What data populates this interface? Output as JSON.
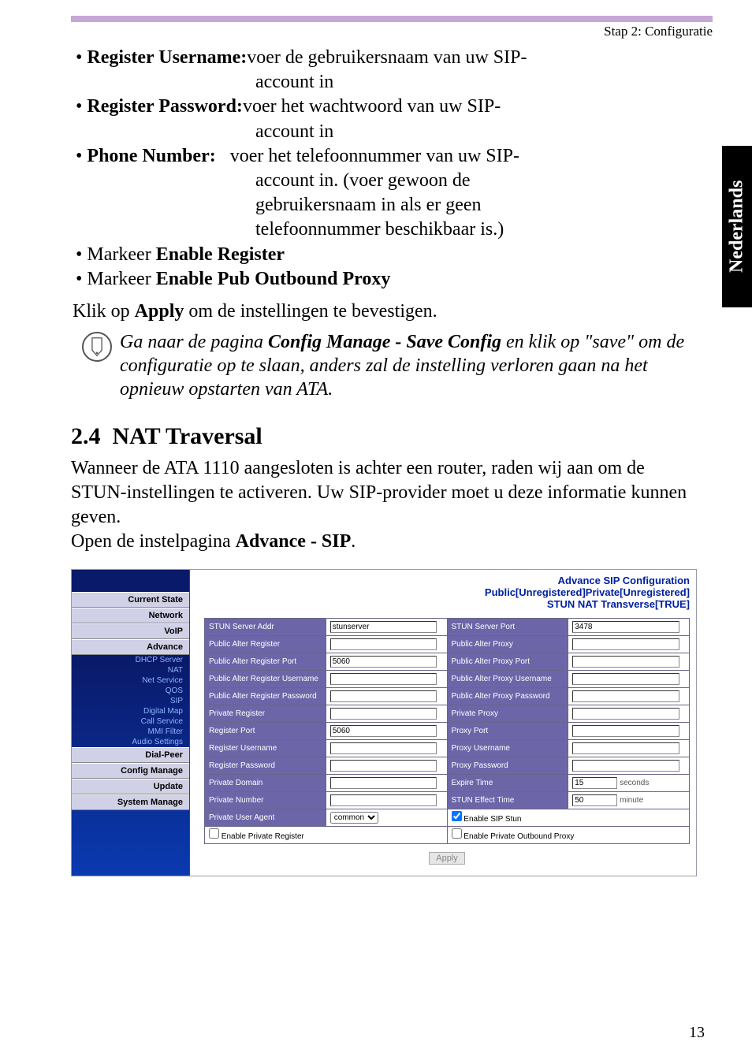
{
  "breadcrumb": "Stap 2: Configuratie",
  "language_tab": "Nederlands",
  "bullets": {
    "reg_user_label": "Register Username:",
    "reg_user_desc": "voer de gebruikersnaam van uw SIP-account in",
    "reg_pass_label": "Register Password:",
    "reg_pass_desc": "voer het wachtwoord van uw SIP-account in",
    "phone_label": "Phone Number:",
    "phone_desc": "voer het telefoonnummer van uw SIP-account in. (voer gewoon de gebruikersnaam in als er geen telefoonnummer beschikbaar is.)",
    "check1_pre": "Markeer ",
    "check1_bold": "Enable Register",
    "check2_pre": "Markeer ",
    "check2_bold": "Enable Pub Outbound Proxy"
  },
  "apply_line": {
    "pre": "Klik op ",
    "bold": "Apply",
    "post": " om de instellingen te bevestigen."
  },
  "note": {
    "pre": "Ga naar de pagina ",
    "bold": "Config Manage - Save Config",
    "post": " en klik op \"save\" om de configuratie op te slaan, anders zal de instelling verloren gaan na het opnieuw opstarten van ATA."
  },
  "section": {
    "number": "2.4",
    "title": "NAT Traversal",
    "body_pre": "Wanneer de ATA 1110 aangesloten is achter een router, raden wij aan om de STUN-instellingen te activeren. Uw SIP-provider moet u deze informatie kunnen geven.\nOpen de instelpagina ",
    "body_bold": "Advance - SIP",
    "body_post": "."
  },
  "shot": {
    "titles": [
      "Advance SIP Configuration",
      "Public[Unregistered]Private[Unregistered]",
      "STUN NAT Transverse[TRUE]"
    ],
    "menu_main": [
      "Current State",
      "Network",
      "VoIP",
      "Advance"
    ],
    "menu_sub": [
      "DHCP Server",
      "NAT",
      "Net Service",
      "QOS",
      "SIP",
      "Digital Map",
      "Call Service",
      "MMI Filter",
      "Audio Settings"
    ],
    "menu_tail": [
      "Dial-Peer",
      "Config Manage",
      "Update",
      "System Manage"
    ],
    "rows": [
      {
        "l1": "STUN Server Addr",
        "v1": "stunserver",
        "l2": "STUN Server Port",
        "v2": "3478"
      },
      {
        "l1": "Public Alter Register",
        "v1": "",
        "l2": "Public Alter Proxy",
        "v2": ""
      },
      {
        "l1": "Public Alter Register Port",
        "v1": "5060",
        "l2": "Public Alter Proxy Port",
        "v2": ""
      },
      {
        "l1": "Public Alter Register Username",
        "v1": "",
        "l2": "Public Alter Proxy Username",
        "v2": ""
      },
      {
        "l1": "Public Alter Register Password",
        "v1": "",
        "l2": "Public Alter Proxy Password",
        "v2": ""
      },
      {
        "l1": "Private Register",
        "v1": "",
        "l2": "Private Proxy",
        "v2": ""
      },
      {
        "l1": "Register Port",
        "v1": "5060",
        "l2": "Proxy Port",
        "v2": ""
      },
      {
        "l1": "Register Username",
        "v1": "",
        "l2": "Proxy Username",
        "v2": ""
      },
      {
        "l1": "Register Password",
        "v1": "",
        "l2": "Proxy Password",
        "v2": ""
      },
      {
        "l1": "Private Domain",
        "v1": "",
        "l2": "Expire Time",
        "v2": "15",
        "unit2": "seconds"
      },
      {
        "l1": "Private Number",
        "v1": "",
        "l2": "STUN Effect Time",
        "v2": "50",
        "unit2": "minute"
      },
      {
        "l1": "Private User Agent",
        "v1": "common",
        "select": true,
        "l2": "Enable SIP Stun",
        "cb2": true
      }
    ],
    "bottom": {
      "cb1": "Enable Private Register",
      "cb2": "Enable Private Outbound Proxy"
    },
    "apply": "Apply"
  },
  "page_number": "13"
}
